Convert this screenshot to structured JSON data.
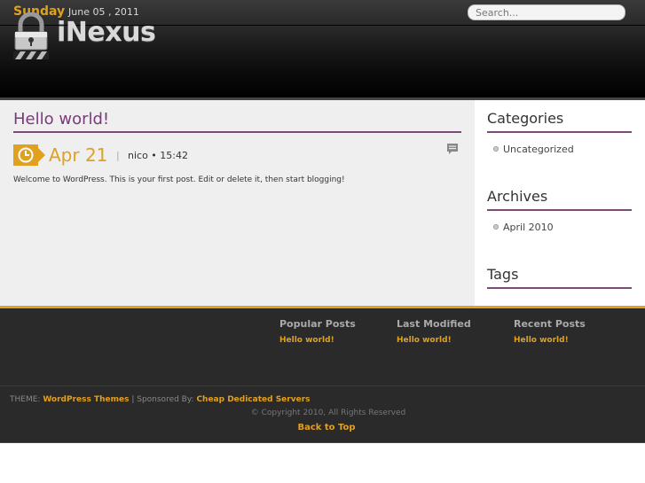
{
  "topbar": {
    "day": "Sunday",
    "date": "June 05 , 2011",
    "search_placeholder": "Search..."
  },
  "header": {
    "logo_text": "iNexus",
    "logo_icon": "lock-icon"
  },
  "post": {
    "title": "Hello world!",
    "date": "Apr 21",
    "separator": "|",
    "author_time": "nico • 15:42",
    "body": "Welcome to WordPress. This is your first post. Edit or delete it, then start blogging!"
  },
  "sidebar": {
    "categories": {
      "heading": "Categories",
      "items": [
        "Uncategorized"
      ]
    },
    "archives": {
      "heading": "Archives",
      "items": [
        "April 2010"
      ]
    },
    "tags": {
      "heading": "Tags"
    }
  },
  "footer": {
    "columns": [
      {
        "title": "Popular Posts",
        "link": "Hello world!"
      },
      {
        "title": "Last Modified",
        "link": "Hello world!"
      },
      {
        "title": "Recent Posts",
        "link": "Hello world!"
      }
    ],
    "credits_prefix": "THEME:",
    "credits_theme_link": "WordPress Themes",
    "credits_middle": "| Sponsored By:",
    "credits_sponsor_link": "Cheap Dedicated Servers",
    "copyright": "© Copyright 2010, All Rights Reserved",
    "back_to_top": "Back to Top"
  },
  "colors": {
    "accent": "#e0a020",
    "title_purple": "#7a3a7a",
    "rule_purple": "#7a4a7a"
  }
}
